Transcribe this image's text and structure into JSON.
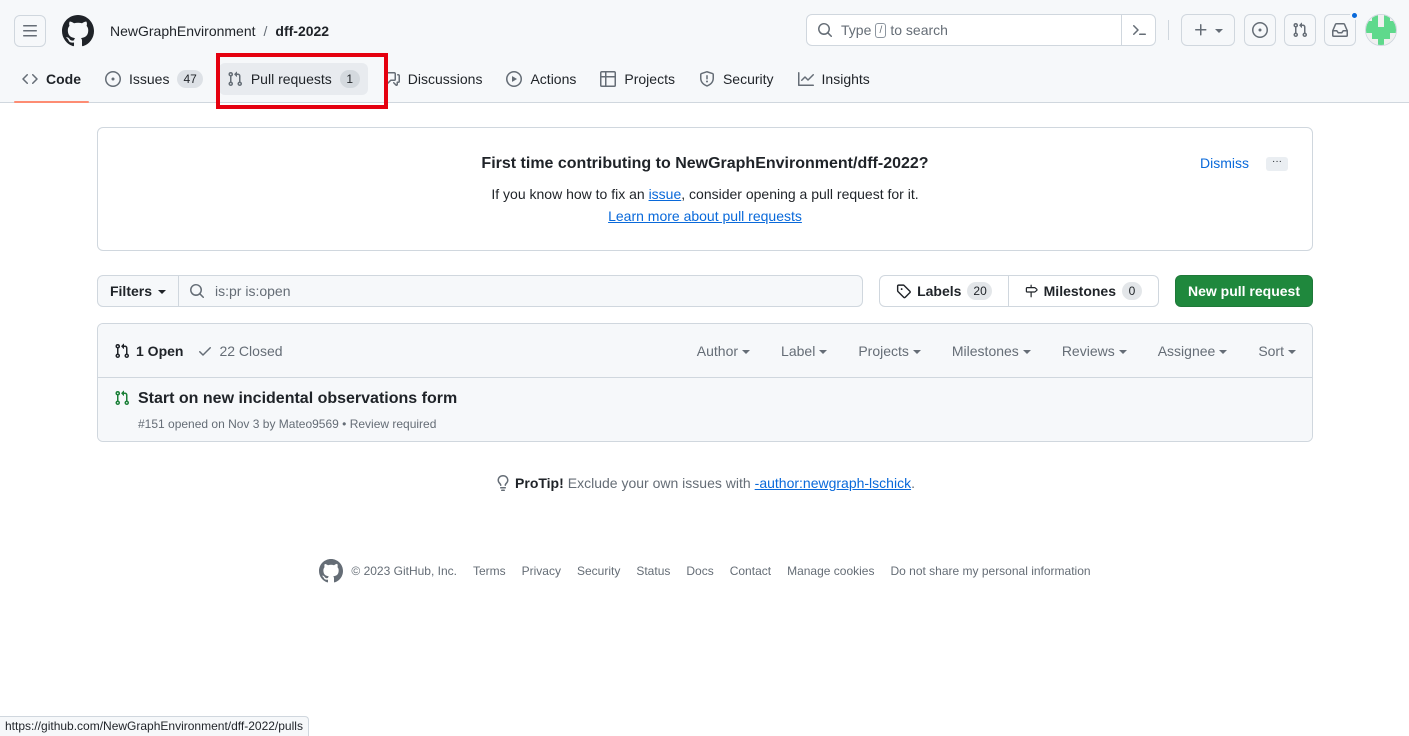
{
  "header": {
    "owner": "NewGraphEnvironment",
    "separator": "/",
    "repo": "dff-2022",
    "search_pre": "Type",
    "search_key": "/",
    "search_post": "to search"
  },
  "nav": {
    "code": "Code",
    "issues": "Issues",
    "issues_count": "47",
    "pull_requests": "Pull requests",
    "pull_requests_count": "1",
    "discussions": "Discussions",
    "actions": "Actions",
    "projects": "Projects",
    "security": "Security",
    "insights": "Insights"
  },
  "banner": {
    "title": "First time contributing to NewGraphEnvironment/dff-2022?",
    "text_pre": "If you know how to fix an ",
    "text_link": "issue",
    "text_post": ", consider opening a pull request for it.",
    "learn_more": "Learn more about pull requests",
    "dismiss": "Dismiss",
    "more": "···"
  },
  "toolbar": {
    "filters": "Filters",
    "query": "is:pr is:open",
    "labels": "Labels",
    "labels_count": "20",
    "milestones": "Milestones",
    "milestones_count": "0",
    "new_pr": "New pull request"
  },
  "list": {
    "open": "1 Open",
    "closed": "22 Closed",
    "menus": [
      "Author",
      "Label",
      "Projects",
      "Milestones",
      "Reviews",
      "Assignee",
      "Sort"
    ],
    "items": [
      {
        "title": "Start on new incidental observations form",
        "meta": "#151 opened on Nov 3 by Mateo9569 • Review required"
      }
    ]
  },
  "protip": {
    "label": "ProTip!",
    "text": "Exclude your own issues with",
    "link": "-author:newgraph-lschick",
    "end": "."
  },
  "footer": {
    "copyright": "© 2023 GitHub, Inc.",
    "links": [
      "Terms",
      "Privacy",
      "Security",
      "Status",
      "Docs",
      "Contact",
      "Manage cookies",
      "Do not share my personal information"
    ]
  },
  "statusbar": {
    "url": "https://github.com/NewGraphEnvironment/dff-2022/pulls"
  },
  "colors": {
    "highlight": "#e5000f",
    "primary_button": "#1f883d",
    "link": "#0969da",
    "open_icon": "#1a7f37",
    "selected_tab_underline": "#fd8c73"
  }
}
